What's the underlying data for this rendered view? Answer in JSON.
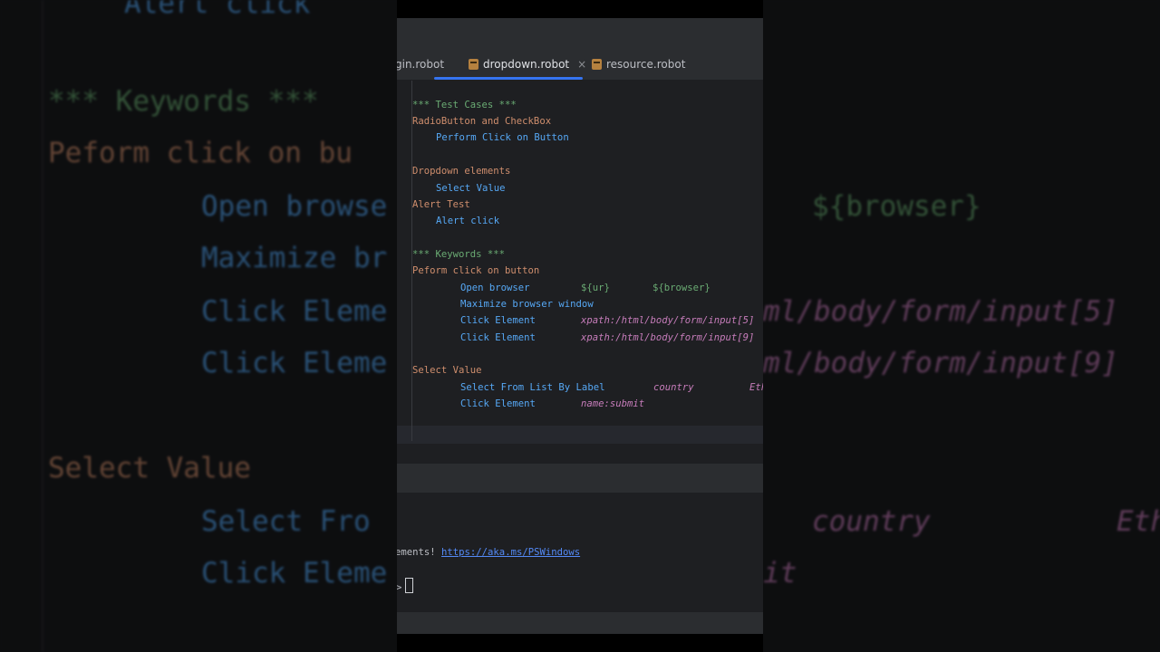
{
  "tabs": [
    {
      "label": "gin.robot",
      "active": false
    },
    {
      "label": "dropdown.robot",
      "active": true,
      "close": "×"
    },
    {
      "label": "resource.robot",
      "active": false
    }
  ],
  "code": {
    "test_cases_header": "*** Test Cases ***",
    "tc1_name": "RadioButton and CheckBox",
    "tc1_step": "Perform Click on Button",
    "tc2_name": "Dropdown elements",
    "tc2_step": "Select Value",
    "tc3_name": "Alert Test",
    "tc3_step": "Alert click",
    "keywords_header": "*** Keywords ***",
    "kw1_name": "Peform click on button",
    "kw1_l1_kw": "Open browser",
    "kw1_l1_arg1": "${ur}",
    "kw1_l1_arg2": "${browser}",
    "kw1_l2_kw": "Maximize browser window",
    "kw1_l3_kw": "Click Element",
    "kw1_l3_arg": "xpath:/html/body/form/input[5]",
    "kw1_l4_kw": "Click Element",
    "kw1_l4_arg": "xpath:/html/body/form/input[9]",
    "kw2_name": "Select Value",
    "kw2_l1_kw": "Select From List By Label",
    "kw2_l1_arg1": "country",
    "kw2_l1_arg2": "Eth",
    "kw2_l2_kw": "Click Element",
    "kw2_l2_arg": "name:submit"
  },
  "terminal": {
    "line1_text": "ements! ",
    "line1_link": "https://aka.ms/PSWindows",
    "prompt": ">"
  },
  "background": {
    "l1": "Alert click",
    "l2": "*** Keywords ***",
    "l3": "Peform click on bu",
    "l4": "Open browse",
    "l4r": "${browser}",
    "l5": "Maximize br",
    "l6": "Click Eleme",
    "l6r": "ml/body/form/input[5]",
    "l7": "Click Eleme",
    "l7r": "ml/body/form/input[9]",
    "l8": "Select Value",
    "l9": "Select Fro",
    "l9r1": "country",
    "l9r2": "Eth",
    "l10": "Click Eleme",
    "l10r": "it"
  },
  "colors": {
    "section": "#6aab73",
    "testcase": "#cf8e6d",
    "keyword": "#56a8f5",
    "argument": "#c77dbb",
    "accent": "#3574f0"
  }
}
